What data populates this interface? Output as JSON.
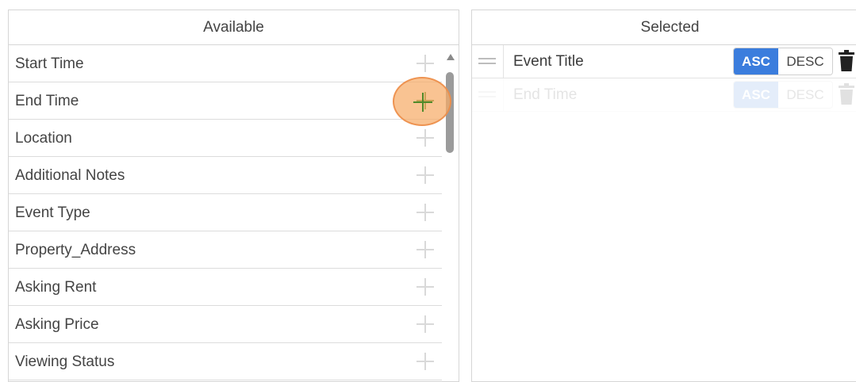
{
  "available": {
    "header": "Available",
    "items": [
      {
        "label": "Start Time"
      },
      {
        "label": "End Time"
      },
      {
        "label": "Location"
      },
      {
        "label": "Additional Notes"
      },
      {
        "label": "Event Type"
      },
      {
        "label": "Property_Address"
      },
      {
        "label": "Asking Rent"
      },
      {
        "label": "Asking Price"
      },
      {
        "label": "Viewing Status"
      }
    ]
  },
  "selected": {
    "header": "Selected",
    "items": [
      {
        "label": "Event Title",
        "asc": "ASC",
        "desc": "DESC"
      },
      {
        "label": "End Time",
        "asc": "ASC",
        "desc": "DESC"
      }
    ]
  },
  "icons": {
    "add": "plus-icon",
    "drag": "drag-handle-icon",
    "delete": "trash-icon",
    "scroll_up": "scroll-up-arrow-icon"
  },
  "colors": {
    "accent": "#3b7ddd",
    "add_active": "#4f8a2a",
    "click_highlight": "#f6ac68"
  }
}
